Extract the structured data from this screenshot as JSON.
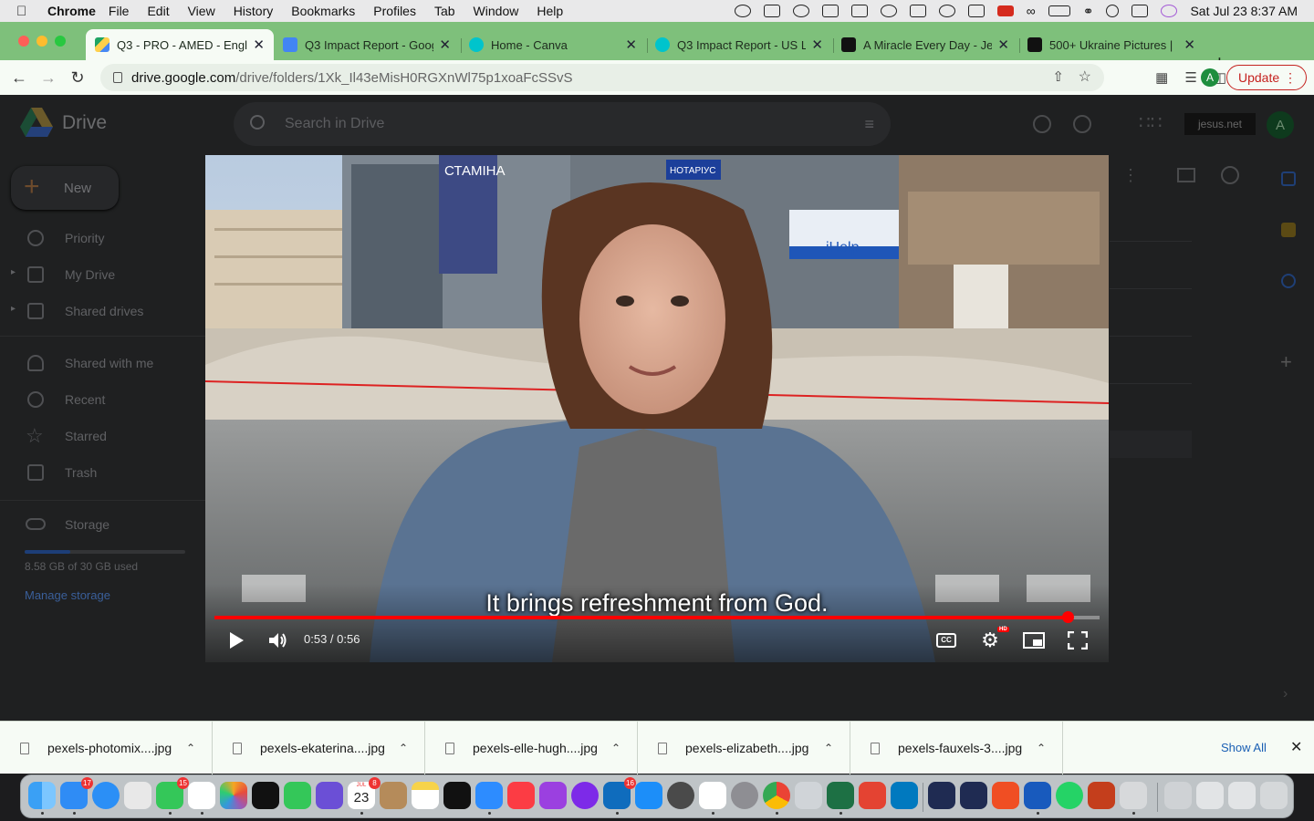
{
  "menubar": {
    "app": "Chrome",
    "items": [
      "File",
      "Edit",
      "View",
      "History",
      "Bookmarks",
      "Profiles",
      "Tab",
      "Window",
      "Help"
    ],
    "datetime": "Sat Jul 23  8:37 AM"
  },
  "tabs": [
    {
      "title": "Q3 - PRO - AMED - Engl",
      "favicon_color": "#1f73e8"
    },
    {
      "title": "Q3 Impact Report - Goog",
      "favicon_color": "#4285f4"
    },
    {
      "title": "Home - Canva",
      "favicon_color": "#00c4cc"
    },
    {
      "title": "Q3 Impact Report - US L",
      "favicon_color": "#00c4cc"
    },
    {
      "title": "A Miracle Every Day - Je",
      "favicon_color": "#111111"
    },
    {
      "title": "500+ Ukraine Pictures | ",
      "favicon_color": "#111111"
    }
  ],
  "address": {
    "domain": "drive.google.com",
    "path": "/drive/folders/1Xk_Il43eMisH0RGXnWl75p1xoaFcSSvS"
  },
  "toolbar": {
    "profile_initial": "A",
    "update_label": "Update"
  },
  "drive": {
    "title": "Drive",
    "search_placeholder": "Search in Drive",
    "org_label": "jesus.net",
    "avatar_initial": "A",
    "new_label": "New",
    "nav": [
      {
        "label": "Priority"
      },
      {
        "label": "My Drive"
      },
      {
        "label": "Shared drives"
      },
      {
        "label": "Shared with me"
      },
      {
        "label": "Recent"
      },
      {
        "label": "Starred"
      },
      {
        "label": "Trash"
      }
    ],
    "storage_label": "Storage",
    "storage_used_fraction": 0.286,
    "storage_text": "8.58 GB of 30 GB used",
    "manage_storage": "Manage storage"
  },
  "video": {
    "caption": "It brings refreshment from God.",
    "current": "0:53",
    "duration": "0:56",
    "progress_fraction": 0.964,
    "time_display": "0:53 / 0:56",
    "hd_badge": "HD",
    "scene_text": {
      "sign_stamina": "СТАМІНА",
      "sign_notary": "НОТАРІУС",
      "sign_help": "iHelp"
    }
  },
  "downloads": {
    "files": [
      "pexels-photomix....jpg",
      "pexels-ekaterina....jpg",
      "pexels-elle-hugh....jpg",
      "pexels-elizabeth....jpg",
      "pexels-fauxels-3....jpg"
    ],
    "show_all": "Show All"
  },
  "dock": {
    "calendar_day": "23",
    "calendar_month": "JUL",
    "badges": {
      "mail": "17",
      "messages": "15",
      "calendar": "8",
      "outlook": "16"
    }
  }
}
